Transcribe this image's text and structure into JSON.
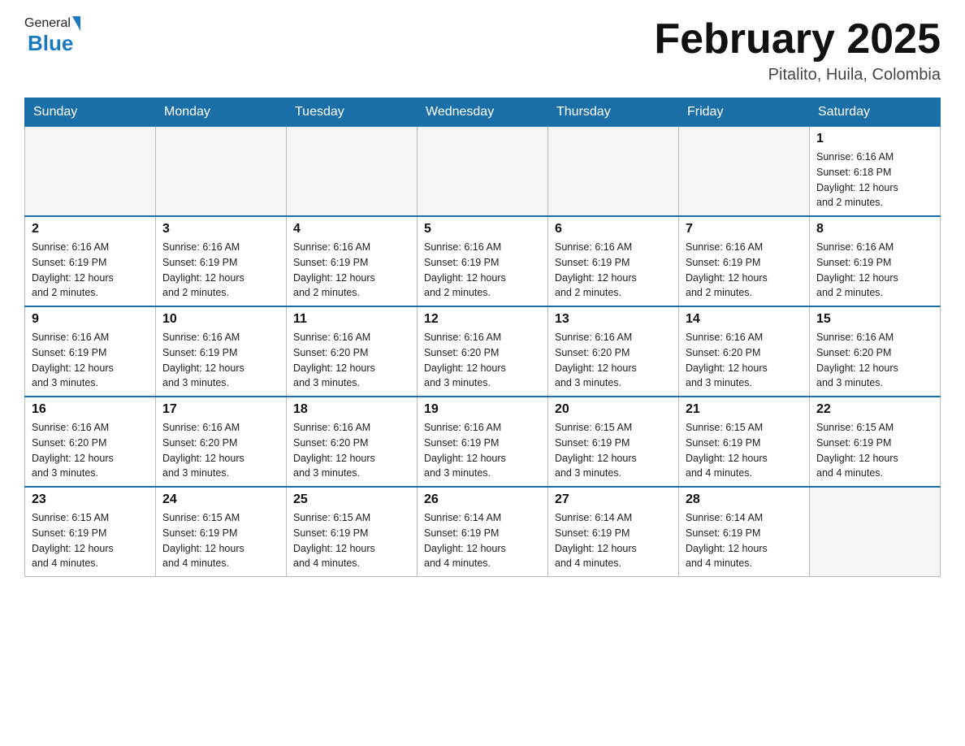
{
  "header": {
    "logo_general": "General",
    "logo_blue": "Blue",
    "month_title": "February 2025",
    "location": "Pitalito, Huila, Colombia"
  },
  "days_of_week": [
    "Sunday",
    "Monday",
    "Tuesday",
    "Wednesday",
    "Thursday",
    "Friday",
    "Saturday"
  ],
  "weeks": [
    {
      "days": [
        {
          "num": "",
          "info": "",
          "empty": true
        },
        {
          "num": "",
          "info": "",
          "empty": true
        },
        {
          "num": "",
          "info": "",
          "empty": true
        },
        {
          "num": "",
          "info": "",
          "empty": true
        },
        {
          "num": "",
          "info": "",
          "empty": true
        },
        {
          "num": "",
          "info": "",
          "empty": true
        },
        {
          "num": "1",
          "info": "Sunrise: 6:16 AM\nSunset: 6:18 PM\nDaylight: 12 hours\nand 2 minutes.",
          "empty": false
        }
      ]
    },
    {
      "days": [
        {
          "num": "2",
          "info": "Sunrise: 6:16 AM\nSunset: 6:19 PM\nDaylight: 12 hours\nand 2 minutes.",
          "empty": false
        },
        {
          "num": "3",
          "info": "Sunrise: 6:16 AM\nSunset: 6:19 PM\nDaylight: 12 hours\nand 2 minutes.",
          "empty": false
        },
        {
          "num": "4",
          "info": "Sunrise: 6:16 AM\nSunset: 6:19 PM\nDaylight: 12 hours\nand 2 minutes.",
          "empty": false
        },
        {
          "num": "5",
          "info": "Sunrise: 6:16 AM\nSunset: 6:19 PM\nDaylight: 12 hours\nand 2 minutes.",
          "empty": false
        },
        {
          "num": "6",
          "info": "Sunrise: 6:16 AM\nSunset: 6:19 PM\nDaylight: 12 hours\nand 2 minutes.",
          "empty": false
        },
        {
          "num": "7",
          "info": "Sunrise: 6:16 AM\nSunset: 6:19 PM\nDaylight: 12 hours\nand 2 minutes.",
          "empty": false
        },
        {
          "num": "8",
          "info": "Sunrise: 6:16 AM\nSunset: 6:19 PM\nDaylight: 12 hours\nand 2 minutes.",
          "empty": false
        }
      ]
    },
    {
      "days": [
        {
          "num": "9",
          "info": "Sunrise: 6:16 AM\nSunset: 6:19 PM\nDaylight: 12 hours\nand 3 minutes.",
          "empty": false
        },
        {
          "num": "10",
          "info": "Sunrise: 6:16 AM\nSunset: 6:19 PM\nDaylight: 12 hours\nand 3 minutes.",
          "empty": false
        },
        {
          "num": "11",
          "info": "Sunrise: 6:16 AM\nSunset: 6:20 PM\nDaylight: 12 hours\nand 3 minutes.",
          "empty": false
        },
        {
          "num": "12",
          "info": "Sunrise: 6:16 AM\nSunset: 6:20 PM\nDaylight: 12 hours\nand 3 minutes.",
          "empty": false
        },
        {
          "num": "13",
          "info": "Sunrise: 6:16 AM\nSunset: 6:20 PM\nDaylight: 12 hours\nand 3 minutes.",
          "empty": false
        },
        {
          "num": "14",
          "info": "Sunrise: 6:16 AM\nSunset: 6:20 PM\nDaylight: 12 hours\nand 3 minutes.",
          "empty": false
        },
        {
          "num": "15",
          "info": "Sunrise: 6:16 AM\nSunset: 6:20 PM\nDaylight: 12 hours\nand 3 minutes.",
          "empty": false
        }
      ]
    },
    {
      "days": [
        {
          "num": "16",
          "info": "Sunrise: 6:16 AM\nSunset: 6:20 PM\nDaylight: 12 hours\nand 3 minutes.",
          "empty": false
        },
        {
          "num": "17",
          "info": "Sunrise: 6:16 AM\nSunset: 6:20 PM\nDaylight: 12 hours\nand 3 minutes.",
          "empty": false
        },
        {
          "num": "18",
          "info": "Sunrise: 6:16 AM\nSunset: 6:20 PM\nDaylight: 12 hours\nand 3 minutes.",
          "empty": false
        },
        {
          "num": "19",
          "info": "Sunrise: 6:16 AM\nSunset: 6:19 PM\nDaylight: 12 hours\nand 3 minutes.",
          "empty": false
        },
        {
          "num": "20",
          "info": "Sunrise: 6:15 AM\nSunset: 6:19 PM\nDaylight: 12 hours\nand 3 minutes.",
          "empty": false
        },
        {
          "num": "21",
          "info": "Sunrise: 6:15 AM\nSunset: 6:19 PM\nDaylight: 12 hours\nand 4 minutes.",
          "empty": false
        },
        {
          "num": "22",
          "info": "Sunrise: 6:15 AM\nSunset: 6:19 PM\nDaylight: 12 hours\nand 4 minutes.",
          "empty": false
        }
      ]
    },
    {
      "days": [
        {
          "num": "23",
          "info": "Sunrise: 6:15 AM\nSunset: 6:19 PM\nDaylight: 12 hours\nand 4 minutes.",
          "empty": false
        },
        {
          "num": "24",
          "info": "Sunrise: 6:15 AM\nSunset: 6:19 PM\nDaylight: 12 hours\nand 4 minutes.",
          "empty": false
        },
        {
          "num": "25",
          "info": "Sunrise: 6:15 AM\nSunset: 6:19 PM\nDaylight: 12 hours\nand 4 minutes.",
          "empty": false
        },
        {
          "num": "26",
          "info": "Sunrise: 6:14 AM\nSunset: 6:19 PM\nDaylight: 12 hours\nand 4 minutes.",
          "empty": false
        },
        {
          "num": "27",
          "info": "Sunrise: 6:14 AM\nSunset: 6:19 PM\nDaylight: 12 hours\nand 4 minutes.",
          "empty": false
        },
        {
          "num": "28",
          "info": "Sunrise: 6:14 AM\nSunset: 6:19 PM\nDaylight: 12 hours\nand 4 minutes.",
          "empty": false
        },
        {
          "num": "",
          "info": "",
          "empty": true
        }
      ]
    }
  ]
}
